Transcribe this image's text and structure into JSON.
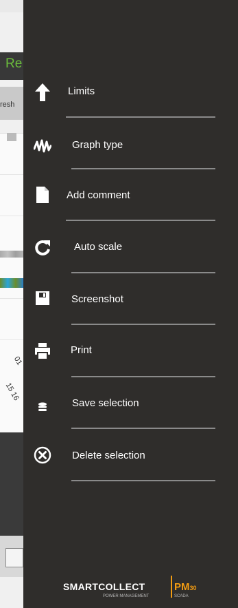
{
  "background": {
    "header_text": "Re",
    "pill_text": "resh",
    "tick_1": "01",
    "tick_2": "15 16"
  },
  "menu": {
    "items": [
      {
        "label": "Limits",
        "icon": "arrow-up-icon"
      },
      {
        "label": "Graph type",
        "icon": "waveform-icon"
      },
      {
        "label": "Add comment",
        "icon": "document-icon"
      },
      {
        "label": "Auto scale",
        "icon": "refresh-icon"
      },
      {
        "label": "Screenshot",
        "icon": "floppy-disk-icon"
      },
      {
        "label": "Print",
        "icon": "printer-icon"
      },
      {
        "label": "Save selection",
        "icon": "database-icon"
      },
      {
        "label": "Delete selection",
        "icon": "close-circle-icon"
      }
    ]
  },
  "footer": {
    "brand": "SMARTCOLLECT",
    "brand_sub": "POWER MANAGEMENT",
    "product": "PM",
    "product_version": "30",
    "product_sub": "SCADA"
  },
  "colors": {
    "panel_bg": "#2f2d2b",
    "divider": "#8a8a8a",
    "accent_orange": "#f39c12",
    "accent_green": "#4caf50"
  }
}
